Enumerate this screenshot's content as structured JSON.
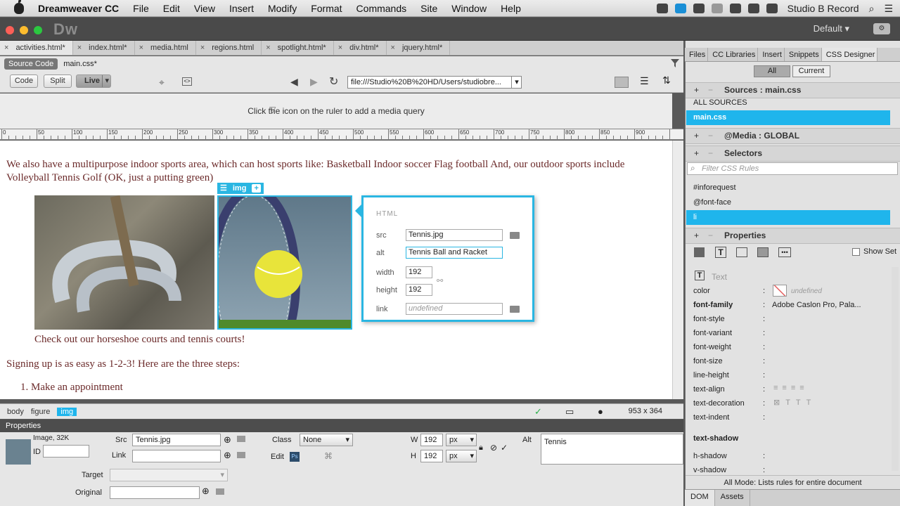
{
  "menubar": {
    "app": "Dreamweaver CC",
    "items": [
      "File",
      "Edit",
      "View",
      "Insert",
      "Modify",
      "Format",
      "Commands",
      "Site",
      "Window",
      "Help"
    ],
    "user": "Studio B Record"
  },
  "appbar": {
    "logo": "Dw",
    "workspace": "Default"
  },
  "doc_tabs": [
    "activities.html*",
    "index.html*",
    "media.html",
    "regions.html",
    "spotlight.html*",
    "div.html*",
    "jquery.html*"
  ],
  "related": {
    "source": "Source Code",
    "file": "main.css*"
  },
  "toolbar": {
    "code": "Code",
    "split": "Split",
    "live": "Live",
    "url": "file:///Studio%20B%20HD/Users/studiobre..."
  },
  "mq_text": "Click the  icon on the ruler to add a media query",
  "ruler": [
    "0",
    "50",
    "100",
    "150",
    "200",
    "250",
    "300",
    "350",
    "400",
    "450",
    "500",
    "550",
    "600",
    "650",
    "700",
    "750",
    "800",
    "850",
    "900"
  ],
  "live": {
    "para1": "We also have a multipurpose indoor sports area, which can host sports like: Basketball Indoor soccer Flag football And, our outdoor sports include Volleyball Tennis Golf (OK, just a putting green)",
    "img_tag": "img",
    "caption": "Check out our horseshoe courts and tennis courts!",
    "para2": "Signing up is as easy as 1-2-3! Here are the three steps:",
    "li1": "1.  Make an appointment"
  },
  "hud": {
    "title": "HTML",
    "src_label": "src",
    "src": "Tennis.jpg",
    "alt_label": "alt",
    "alt": "Tennis Ball and Racket",
    "width_label": "width",
    "width": "192",
    "height_label": "height",
    "height": "192",
    "link_label": "link",
    "link": "undefined"
  },
  "status": {
    "crumbs": [
      "body",
      "figure",
      "img"
    ],
    "size": "953 x 364"
  },
  "props": {
    "title": "Properties",
    "image_info": "Image, 32K",
    "id_label": "ID",
    "src_label": "Src",
    "src": "Tennis.jpg",
    "link_label": "Link",
    "class_label": "Class",
    "class": "None",
    "edit_label": "Edit",
    "w_label": "W",
    "w": "192",
    "w_unit": "px",
    "h_label": "H",
    "h": "192",
    "h_unit": "px",
    "alt_label": "Alt",
    "alt": "Tennis",
    "target_label": "Target",
    "original_label": "Original"
  },
  "panel": {
    "tabs": [
      "Files",
      "CC Libraries",
      "Insert",
      "Snippets",
      "CSS Designer"
    ],
    "all": "All",
    "current": "Current",
    "sources_title": "Sources : main.css",
    "sources": [
      "ALL SOURCES",
      "main.css"
    ],
    "media_title": "@Media : GLOBAL",
    "selectors_title": "Selectors",
    "filter_placeholder": "Filter CSS Rules",
    "selectors": [
      "#inforequest",
      "@font-face",
      "li"
    ],
    "properties_title": "Properties",
    "show_set": "Show Set",
    "text_group": "Text",
    "rows": [
      {
        "name": "color",
        "value": "undefined"
      },
      {
        "name": "font-family",
        "value": "Adobe Caslon Pro, Pala..."
      },
      {
        "name": "font-style",
        "value": ""
      },
      {
        "name": "font-variant",
        "value": ""
      },
      {
        "name": "font-weight",
        "value": ""
      },
      {
        "name": "font-size",
        "value": ""
      },
      {
        "name": "line-height",
        "value": ""
      },
      {
        "name": "text-align",
        "value": ""
      },
      {
        "name": "text-decoration",
        "value": ""
      },
      {
        "name": "text-indent",
        "value": ""
      }
    ],
    "text_shadow": "text-shadow",
    "h_shadow": "h-shadow",
    "v_shadow": "v-shadow",
    "mode": "All Mode: Lists rules for entire document",
    "bottom_tabs": [
      "DOM",
      "Assets"
    ]
  },
  "colors": {
    "accent": "#1fb5ec",
    "text_brown": "#6b2a2a"
  }
}
